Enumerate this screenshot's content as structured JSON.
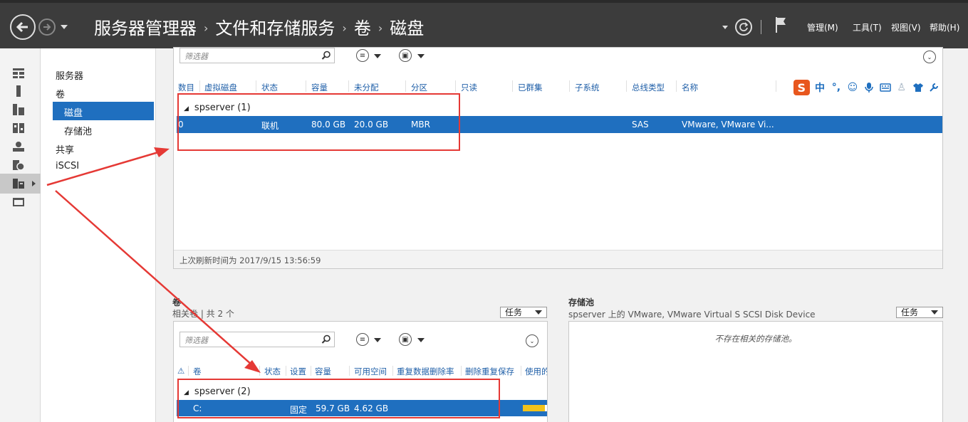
{
  "window": {
    "breadcrumb": [
      "服务器管理器",
      "文件和存储服务",
      "卷",
      "磁盘"
    ],
    "menus": [
      "管理(M)",
      "工具(T)",
      "视图(V)",
      "帮助(H)"
    ]
  },
  "icons": {
    "back": "back-arrow-icon",
    "forward": "forward-arrow-icon",
    "refresh": "refresh-icon",
    "notifications": "flag-icon"
  },
  "nav": {
    "items": [
      {
        "label": "服务器"
      },
      {
        "label": "卷"
      },
      {
        "label": "磁盘",
        "selected": true
      },
      {
        "label": "存储池"
      },
      {
        "label": "共享"
      },
      {
        "label": "iSCSI"
      }
    ]
  },
  "disks": {
    "filter_placeholder": "筛选器",
    "columns": [
      "数目",
      "虚拟磁盘",
      "状态",
      "容量",
      "未分配",
      "分区",
      "只读",
      "已群集",
      "子系统",
      "总线类型",
      "名称"
    ],
    "group": "spserver (1)",
    "row": {
      "number": "0",
      "status": "联机",
      "capacity": "80.0 GB",
      "unallocated": "20.0 GB",
      "partition": "MBR",
      "bus": "SAS",
      "name": "VMware, VMware Vi..."
    },
    "footer": "上次刷新时间为 2017/9/15 13:56:59"
  },
  "volumes": {
    "title": "卷",
    "subtitle": "相关卷 | 共 2 个",
    "tasks_label": "任务",
    "filter_placeholder": "筛选器",
    "columns": [
      "卷",
      "状态",
      "设置",
      "容量",
      "可用空间",
      "重复数据删除率",
      "删除重复保存",
      "使用的"
    ],
    "group": "spserver (2)",
    "row": {
      "volume": "C:",
      "setting": "固定",
      "capacity": "59.7 GB",
      "free": "4.62 GB",
      "usage_fraction": 0.92
    }
  },
  "pools": {
    "title": "存储池",
    "subtitle": "spserver 上的 VMware, VMware Virtual S SCSI Disk Device",
    "tasks_label": "任务",
    "empty": "不存在相关的存储池。"
  },
  "ime": {
    "mode": "中"
  },
  "colors": {
    "accent": "#1f6fbf",
    "annotation": "#e53935",
    "usage_bar": "#f2c21b"
  }
}
